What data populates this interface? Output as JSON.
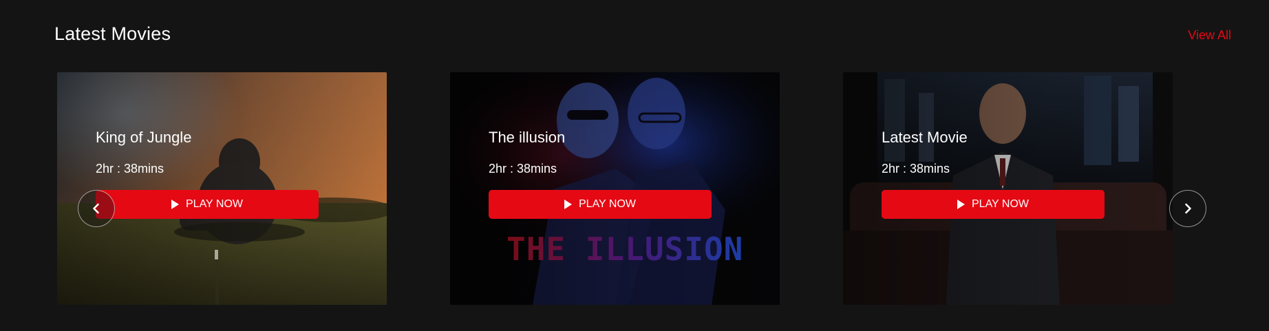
{
  "section": {
    "title": "Latest Movies",
    "view_all_label": "View All"
  },
  "movies": [
    {
      "title": "King of Jungle",
      "duration": "2hr : 38mins",
      "play_label": "PLAY NOW"
    },
    {
      "title": "The illusion",
      "duration": "2hr : 38mins",
      "play_label": "PLAY NOW",
      "poster_logo": "THE ILLUSION"
    },
    {
      "title": "Latest Movie",
      "duration": "2hr : 38mins",
      "play_label": "PLAY NOW"
    }
  ],
  "icons": {
    "prev": "chevron-left-icon",
    "next": "chevron-right-icon",
    "play": "play-icon"
  },
  "colors": {
    "background": "#141414",
    "accent": "#e50914",
    "text": "#ffffff"
  }
}
